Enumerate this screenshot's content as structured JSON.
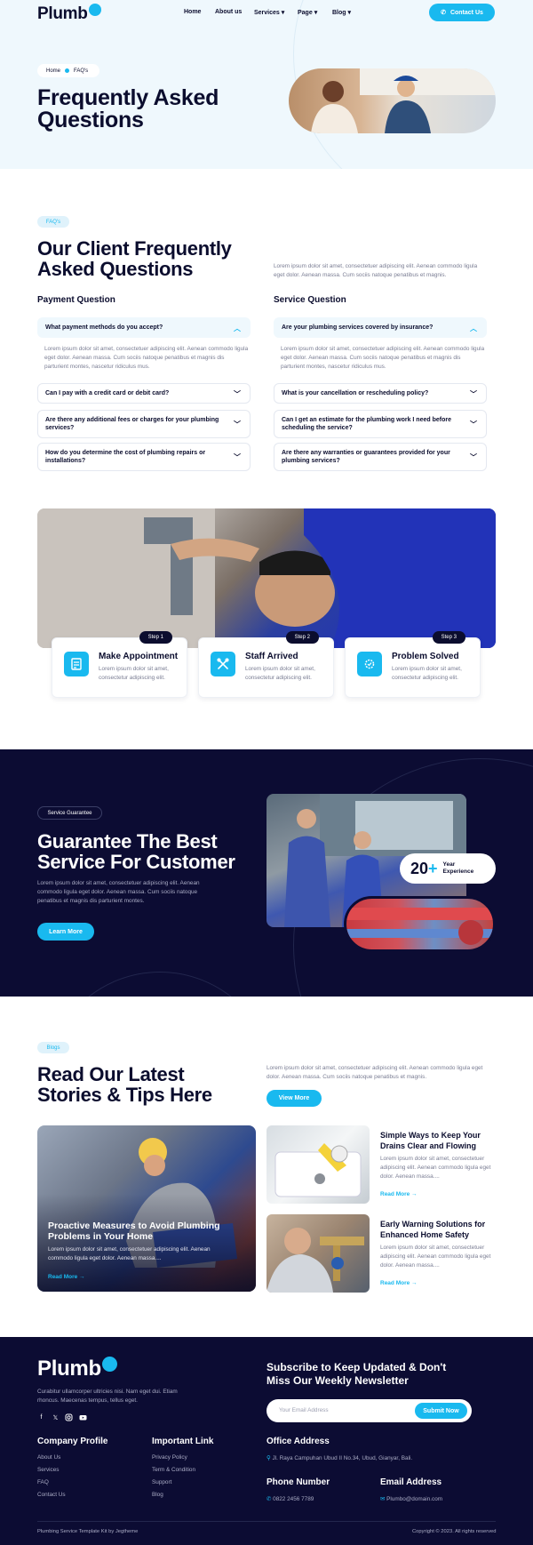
{
  "header": {
    "logo": "Plumb",
    "logo_mark": "o",
    "nav": [
      "Home",
      "About us",
      "Services",
      "Page",
      "Blog"
    ],
    "active_nav": "Page",
    "contact_button": "Contact Us"
  },
  "hero": {
    "breadcrumb": [
      "Home",
      "FAQ's"
    ],
    "title_line1": "Frequently Asked",
    "title_line2": "Questions"
  },
  "faq": {
    "pill": "FAQ's",
    "title_line1": "Our Client Frequently",
    "title_line2": "Asked Questions",
    "intro": "Lorem ipsum dolor sit amet, consectetuer adipiscing elit. Aenean commodo ligula eget dolor. Aenean massa. Cum sociis natoque penatibus et magnis.",
    "payment": {
      "heading": "Payment Question",
      "open_question": "What payment methods do you accept?",
      "answer": "Lorem ipsum dolor sit amet, consectetuer adipiscing elit. Aenean commodo ligula eget dolor. Aenean massa. Cum sociis natoque penatibus et magnis dis parturient montes, nascetur ridiculus mus.",
      "questions": [
        "Can I pay with a credit card or debit card?",
        "Are there any additional fees or charges for your plumbing services?",
        "How do you determine the cost of plumbing repairs or installations?"
      ]
    },
    "service": {
      "heading": "Service Question",
      "open_question": "Are your plumbing services covered by insurance?",
      "answer": "Lorem ipsum dolor sit amet, consectetuer adipiscing elit. Aenean commodo ligula eget dolor. Aenean massa. Cum sociis natoque penatibus et magnis dis parturient montes, nascetur ridiculus mus.",
      "questions": [
        "What is your cancellation or rescheduling policy?",
        "Can I get an estimate for the plumbing work I need before scheduling the service?",
        "Are there any warranties or guarantees provided for your plumbing services?"
      ]
    }
  },
  "steps": [
    {
      "tag": "Step 1",
      "title": "Make Appointment",
      "desc": "Lorem ipsum dolor sit amet, consectetur adipiscing elit.",
      "icon": "calendar-note-icon"
    },
    {
      "tag": "Step 2",
      "title": "Staff Arrived",
      "desc": "Lorem ipsum dolor sit amet, consectetur adipiscing elit.",
      "icon": "tools-icon"
    },
    {
      "tag": "Step 3",
      "title": "Problem Solved",
      "desc": "Lorem ipsum dolor sit amet, consectetur adipiscing elit.",
      "icon": "gear-check-icon"
    }
  ],
  "guarantee": {
    "pill": "Service Guarantee",
    "title_line1": "Guarantee The Best",
    "title_line2": "Service For Customer",
    "desc": "Lorem ipsum dolor sit amet, consectetuer adipiscing elit. Aenean commodo ligula eget dolor. Aenean massa. Cum sociis natoque penatibus et magnis dis parturient montes.",
    "button": "Learn More",
    "years": "20",
    "years_plus": "+",
    "years_label_line1": "Year",
    "years_label_line2": "Experience"
  },
  "blog": {
    "pill": "Blogs",
    "title_line1": "Read Our Latest",
    "title_line2": "Stories & Tips Here",
    "intro": "Lorem ipsum dolor sit amet, consectetuer adipiscing elit. Aenean commodo ligula eget dolor. Aenean massa. Cum sociis natoque penatibus et magnis.",
    "view_more": "View More",
    "main_post": {
      "title_line1": "Proactive Measures to Avoid Plumbing",
      "title_line2": "Problems in Your Home",
      "excerpt": "Lorem ipsum dolor sit amet, consectetuer adipiscing elit. Aenean commodo ligula eget dolor. Aenean massa....",
      "read_more": "Read More"
    },
    "posts": [
      {
        "title_line1": "Simple Ways to Keep Your",
        "title_line2": "Drains Clear and Flowing",
        "excerpt": "Lorem ipsum dolor sit amet, consectetuer adipiscing elit. Aenean commodo ligula eget dolor. Aenean massa....",
        "read_more": "Read More"
      },
      {
        "title_line1": "Early Warning Solutions for",
        "title_line2": "Enhanced Home Safety",
        "excerpt": "Lorem ipsum dolor sit amet, consectetuer adipiscing elit. Aenean commodo ligula eget dolor. Aenean massa....",
        "read_more": "Read More"
      }
    ]
  },
  "footer": {
    "logo": "Plumb",
    "logo_mark": "o",
    "about": "Curabitur ullamcorper ultricies nisi. Nam eget dui. Etiam rhoncus. Maecenas tempus, tellus eget.",
    "social_icons": [
      "facebook-icon",
      "twitter-icon",
      "instagram-icon",
      "youtube-icon"
    ],
    "newsletter_title_line1": "Subscribe to Keep Updated & Don't",
    "newsletter_title_line2": "Miss Our Weekly Newsletter",
    "email_placeholder": "Your Email Address",
    "subscribe_button": "Submit Now",
    "company": {
      "heading": "Company Profile",
      "links": [
        "About Us",
        "Services",
        "FAQ",
        "Contact Us"
      ]
    },
    "important": {
      "heading": "Important Link",
      "links": [
        "Privacy Policy",
        "Term & Condition",
        "Support",
        "Blog"
      ]
    },
    "office": {
      "heading": "Office Address",
      "text": "Jl. Raya Campuhan Ubud II No.34, Ubud, Gianyar, Bali."
    },
    "phone": {
      "heading": "Phone Number",
      "text": "0822 2456 7789"
    },
    "email": {
      "heading": "Email Address",
      "text": "Plumbo@domain.com"
    },
    "bottom_left": "Plumbing Service Template Kit by Jegtheme",
    "bottom_right": "Copyright © 2023. All rights reserved"
  },
  "colors": {
    "accent": "#19b9ef",
    "dark": "#0c0c33",
    "hero_bg": "#eff8fd"
  }
}
